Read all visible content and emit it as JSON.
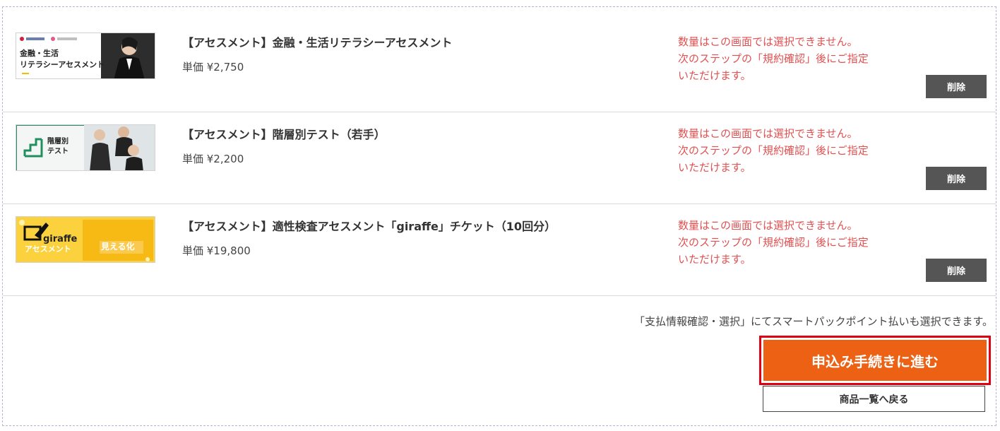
{
  "items": [
    {
      "title": "【アセスメント】金融・生活リテラシーアセスメント",
      "price": "単価 ¥2,750",
      "qty_note": "数量はこの画面では選択できません。\n次のステップの「規約確認」後にご指定\nいただけます。",
      "delete_label": "削除",
      "thumb": {
        "line1": "金融・生活",
        "line2": "リテラシーアセスメント"
      }
    },
    {
      "title": "【アセスメント】階層別テスト（若手）",
      "price": "単価 ¥2,200",
      "qty_note": "数量はこの画面では選択できません。\n次のステップの「規約確認」後にご指定\nいただけます。",
      "delete_label": "削除",
      "thumb": {
        "line1": "階層別",
        "line2": "テスト"
      }
    },
    {
      "title": "【アセスメント】適性検査アセスメント「giraffe」チケット（10回分）",
      "price": "単価 ¥19,800",
      "qty_note": "数量はこの画面では選択できません。\n次のステップの「規約確認」後にご指定\nいただけます。",
      "delete_label": "削除",
      "thumb": {
        "line1": "giraffe",
        "line2": "アセスメント",
        "badge": "見える化"
      }
    }
  ],
  "notice": "「支払情報確認・選択」にてスマートパックポイント払いも選択できます。",
  "proceed_label": "申込み手続きに進む",
  "back_label": "商品一覧へ戻る",
  "colors": {
    "accent_orange": "#ec6114",
    "highlight_red": "#e00012",
    "note_red": "#e05050",
    "delete_gray": "#555555"
  }
}
